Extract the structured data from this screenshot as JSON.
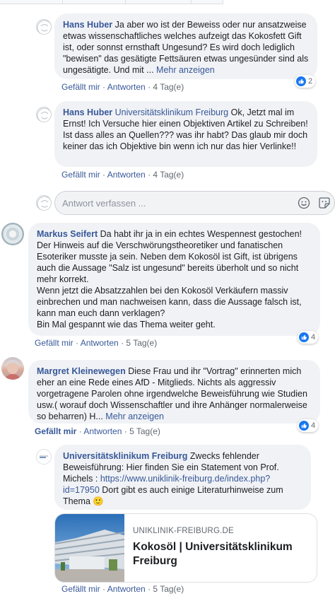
{
  "comments": [
    {
      "author": "Hans Huber",
      "text": "Ja aber wo ist der Beweiss oder nur ansatzweise etwas wissenschaftliches welches aufzeigt das Kokosfett Gift ist, oder sonnst ernsthaft Ungesund? Es wird doch lediglich \"bewisen\" das gesätigte Fettsäuren etwas ungesünder sind als ungesätigte. Und mit ...",
      "more": "Mehr anzeigen",
      "like": "Gefällt mir",
      "reply": "Antworten",
      "time": "4 Tag(e)",
      "reactions": "2"
    },
    {
      "author": "Hans Huber",
      "mention": "Universitätsklinikum Freiburg",
      "text": "Ok, Jetzt mal im Ernst! Ich Versuche hier einen Objektiven Artikel zu Schreiben! Ist dass alles an Quellen??? was ihr habt? Das glaub mir doch keiner das ich Objektive bin wenn ich nur das hier Verlinke!!",
      "like": "Gefällt mir",
      "reply": "Antworten",
      "time": "4 Tag(e)"
    },
    {
      "author": "Markus Seifert",
      "text": "Da habt ihr ja in ein echtes Wespennest gestochen! Der Hinweis auf die Verschwörungstheoretiker und fanatischen Esoteriker musste ja sein. Neben dem Kokosöl ist Gift, ist übrigens auch die Aussage \"Salz ist ungesund\" bereits überholt und so nicht mehr korrekt.",
      "text2": "Wenn jetzt die Absatzzahlen bei den Kokosöl Verkäufern massiv einbrechen und man nachweisen kann, dass die Aussage falsch ist, kann man euch dann verklagen?",
      "text3": "Bin Mal gespannt wie das Thema weiter geht.",
      "like": "Gefällt mir",
      "reply": "Antworten",
      "time": "5 Tag(e)",
      "reactions": "4"
    },
    {
      "author": "Margret Kleinewegen",
      "text": "Diese Frau und ihr \"Vortrag\" erinnerten mich eher an eine Rede eines AfD - Mitglieds. Nichts als aggressiv vorgetragene Parolen ohne irgendwelche Beweisführung wie Studien usw.( worauf doch Wissenschaftler und ihre Anhänger normalerweise so beharren) H...",
      "more": "Mehr anzeigen",
      "like": "Gefällt mir",
      "reply": "Antworten",
      "time": "5 Tag(e)",
      "reactions": "4"
    },
    {
      "author": "Universitätsklinikum Freiburg",
      "text": "Zwecks fehlender Beweisführung: Hier finden Sie ein Statement von Prof. Michels :",
      "url": "https://www.uniklinik-freiburg.de/index.php?id=17950",
      "text2": "Dort gibt es auch einige Literaturhinweise zum Thema",
      "emoji": "🙂",
      "like": "Gefällt mir",
      "reply": "Antworten",
      "time": "5 Tag(e)"
    }
  ],
  "reply_box": {
    "placeholder": "Antwort verfassen ..."
  },
  "link_preview": {
    "domain": "UNIKLINIK-FREIBURG.DE",
    "title": "Kokosöl | Universitätsklinikum Freiburg"
  },
  "separator": "·",
  "colors": {
    "link": "#385898",
    "bubble": "#f0f2f5",
    "like_blue": "#1877f2"
  }
}
